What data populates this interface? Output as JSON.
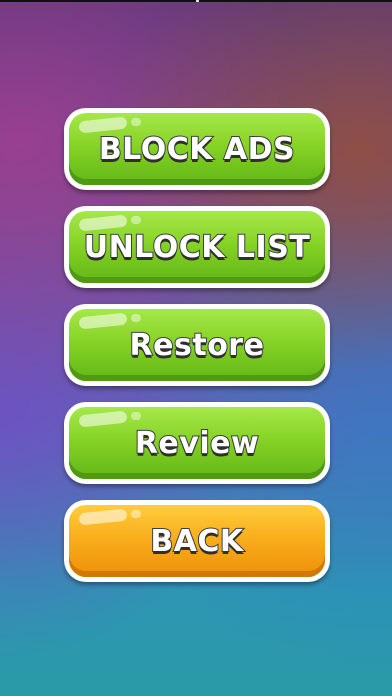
{
  "menu": {
    "buttons": [
      {
        "label": "BLOCK ADS",
        "style": "green"
      },
      {
        "label": "UNLOCK LIST",
        "style": "green"
      },
      {
        "label": "Restore",
        "style": "green"
      },
      {
        "label": "Review",
        "style": "green"
      },
      {
        "label": "BACK",
        "style": "orange"
      }
    ]
  },
  "colors": {
    "green_button": "#86d326",
    "orange_button": "#f9ae1c",
    "button_border": "#ffffff",
    "label_outline": "#3d3d3d"
  }
}
